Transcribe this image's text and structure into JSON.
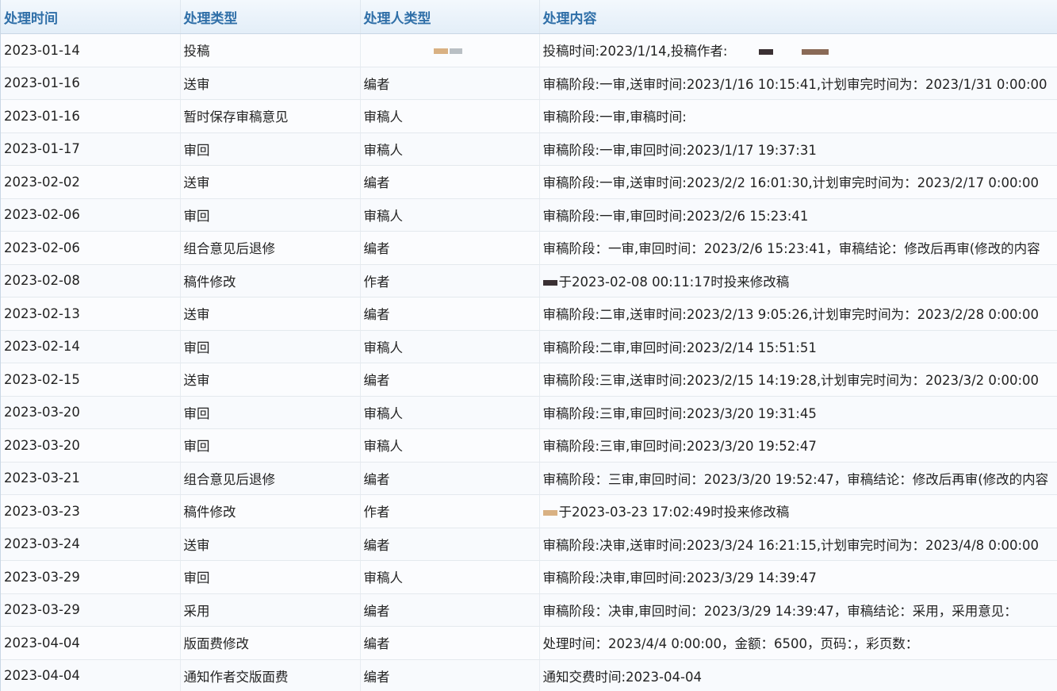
{
  "table": {
    "headers": [
      "处理时间",
      "处理类型",
      "处理人类型",
      "处理内容"
    ],
    "rows": [
      {
        "date": "2023-01-14",
        "type": "投稿",
        "actor": "",
        "content": "投稿时间:2023/1/14,投稿作者:"
      },
      {
        "date": "2023-01-16",
        "type": "送审",
        "actor": "编者",
        "content": "审稿阶段:一审,送审时间:2023/1/16 10:15:41,计划审完时间为：2023/1/31 0:00:00"
      },
      {
        "date": "2023-01-16",
        "type": "暂时保存审稿意见",
        "actor": "审稿人",
        "content": "审稿阶段:一审,审稿时间:"
      },
      {
        "date": "2023-01-17",
        "type": "审回",
        "actor": "审稿人",
        "content": "审稿阶段:一审,审回时间:2023/1/17 19:37:31"
      },
      {
        "date": "2023-02-02",
        "type": "送审",
        "actor": "编者",
        "content": "审稿阶段:一审,送审时间:2023/2/2 16:01:30,计划审完时间为：2023/2/17 0:00:00"
      },
      {
        "date": "2023-02-06",
        "type": "审回",
        "actor": "审稿人",
        "content": "审稿阶段:一审,审回时间:2023/2/6 15:23:41"
      },
      {
        "date": "2023-02-06",
        "type": "组合意见后退修",
        "actor": "编者",
        "content": "审稿阶段：一审,审回时间：2023/2/6 15:23:41，审稿结论：修改后再审(修改的内容"
      },
      {
        "date": "2023-02-08",
        "type": "稿件修改",
        "actor": "作者",
        "content": "于2023-02-08 00:11:17时投来修改稿"
      },
      {
        "date": "2023-02-13",
        "type": "送审",
        "actor": "编者",
        "content": "审稿阶段:二审,送审时间:2023/2/13 9:05:26,计划审完时间为：2023/2/28 0:00:00"
      },
      {
        "date": "2023-02-14",
        "type": "审回",
        "actor": "审稿人",
        "content": "审稿阶段:二审,审回时间:2023/2/14 15:51:51"
      },
      {
        "date": "2023-02-15",
        "type": "送审",
        "actor": "编者",
        "content": "审稿阶段:三审,送审时间:2023/2/15 14:19:28,计划审完时间为：2023/3/2 0:00:00"
      },
      {
        "date": "2023-03-20",
        "type": "审回",
        "actor": "审稿人",
        "content": "审稿阶段:三审,审回时间:2023/3/20 19:31:45"
      },
      {
        "date": "2023-03-20",
        "type": "审回",
        "actor": "审稿人",
        "content": "审稿阶段:三审,审回时间:2023/3/20 19:52:47"
      },
      {
        "date": "2023-03-21",
        "type": "组合意见后退修",
        "actor": "编者",
        "content": "审稿阶段：三审,审回时间：2023/3/20 19:52:47，审稿结论：修改后再审(修改的内容"
      },
      {
        "date": "2023-03-23",
        "type": "稿件修改",
        "actor": "作者",
        "content": "于2023-03-23 17:02:49时投来修改稿"
      },
      {
        "date": "2023-03-24",
        "type": "送审",
        "actor": "编者",
        "content": "审稿阶段:决审,送审时间:2023/3/24 16:21:15,计划审完时间为：2023/4/8 0:00:00"
      },
      {
        "date": "2023-03-29",
        "type": "审回",
        "actor": "审稿人",
        "content": "审稿阶段:决审,审回时间:2023/3/29 14:39:47"
      },
      {
        "date": "2023-03-29",
        "type": "采用",
        "actor": "编者",
        "content": "审稿阶段：决审,审回时间：2023/3/29 14:39:47，审稿结论：采用，采用意见："
      },
      {
        "date": "2023-04-04",
        "type": "版面费修改",
        "actor": "编者",
        "content": "处理时间：2023/4/4 0:00:00，金额：6500，页码：，彩页数："
      },
      {
        "date": "2023-04-04",
        "type": "通知作者交版面费",
        "actor": "编者",
        "content": "通知交费时间:2023-04-04"
      }
    ]
  }
}
